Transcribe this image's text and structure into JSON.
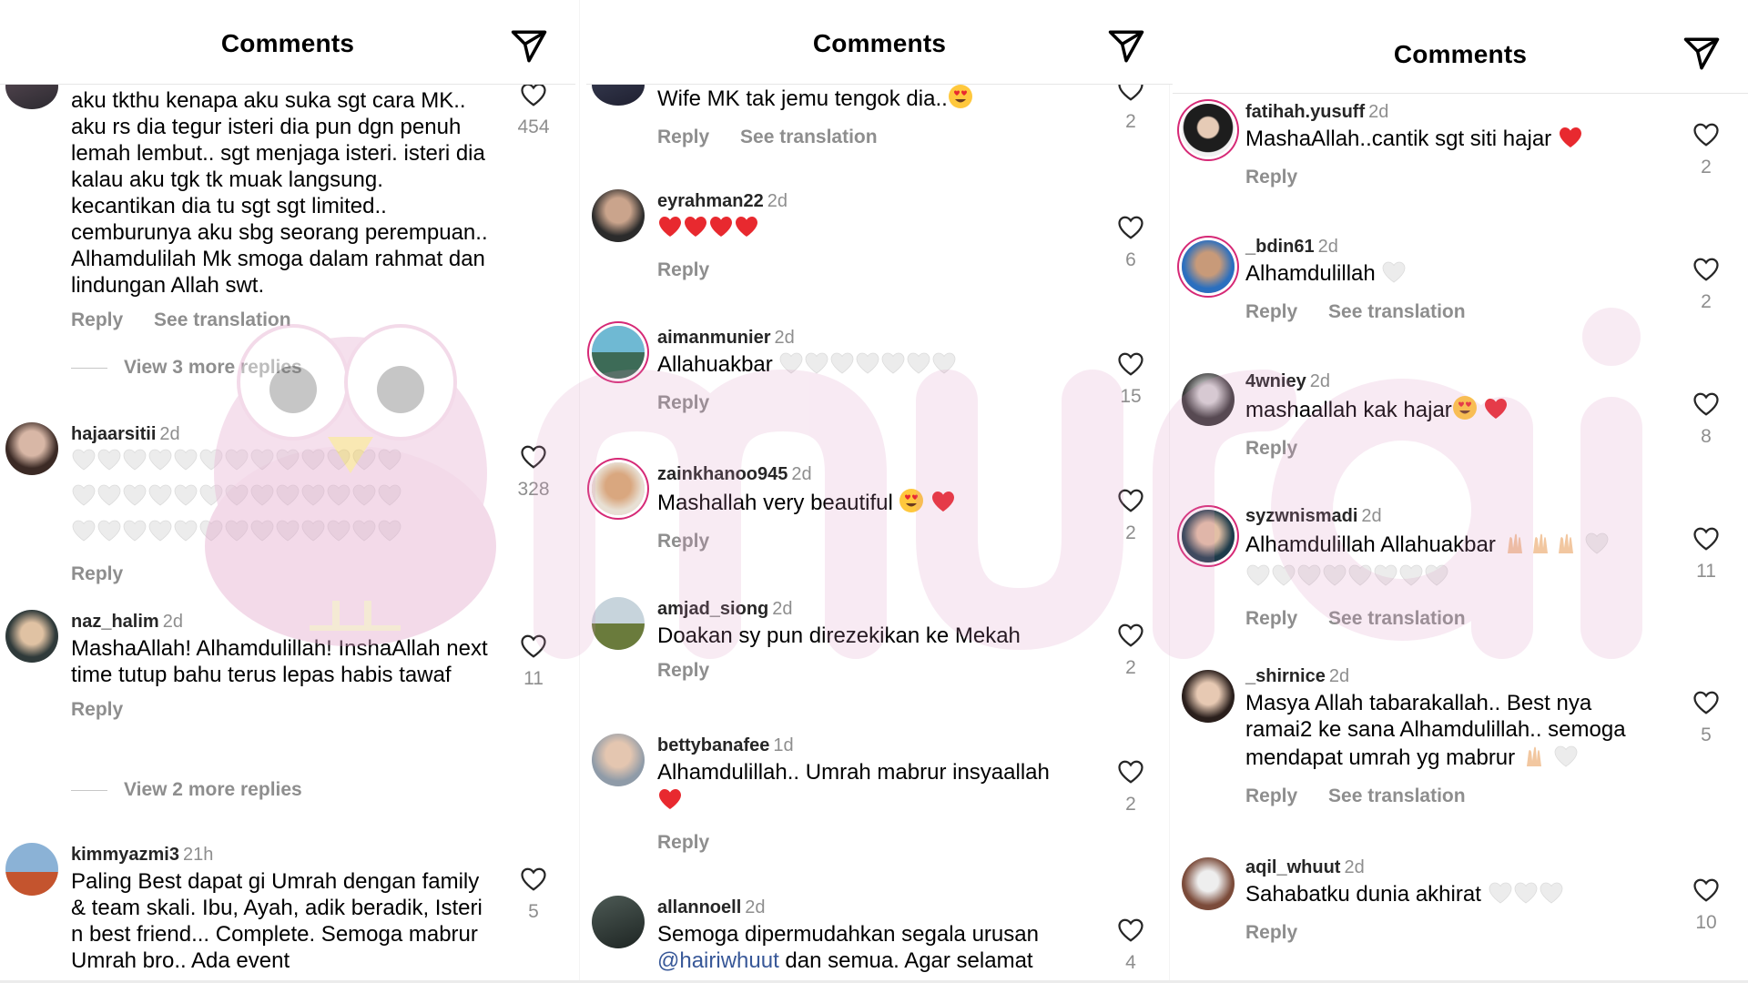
{
  "colors": {
    "heart_red": "#e8292f",
    "heart_white": "#ececec",
    "meta_gray": "#8e8e8e",
    "mention_blue": "#385898",
    "watermark_pink": "#e9c3de"
  },
  "panels": [
    {
      "title": "Comments",
      "comments": [
        {
          "username": "",
          "time": "",
          "text": "aku tkthu kenapa aku suka sgt cara MK.. aku rs dia tegur isteri dia pun dgn penuh lemah lembut.. sgt menjaga isteri. isteri dia kalau aku tgk tk muak langsung. kecantikan dia tu sgt sgt limited.. cemburunya aku sbg seorang perempuan.. Alhamdulilah Mk smoga dalam rahmat dan lindungan Allah swt.",
          "reply": "Reply",
          "see_translation": "See translation",
          "likes": "454",
          "view_replies": "View 3 more replies"
        },
        {
          "username": "hajaarsitii",
          "time": "2d",
          "text": "",
          "reply": "Reply",
          "likes": "328"
        },
        {
          "username": "naz_halim",
          "time": "2d",
          "text": "MashaAllah! Alhamdulillah! InshaAllah next time tutup bahu terus lepas habis tawaf",
          "reply": "Reply",
          "likes": "11",
          "view_replies": "View 2 more replies"
        },
        {
          "username": "kimmyazmi3",
          "time": "21h",
          "text": "Paling Best dapat gi Umrah dengan family & team skali. Ibu, Ayah, adik beradik, Isteri n best friend... Complete. Semoga mabrur Umrah bro.. Ada event",
          "likes": "5"
        }
      ]
    },
    {
      "title": "Comments",
      "comments": [
        {
          "username": "",
          "time": "",
          "text": "Wife MK tak jemu tengok dia..",
          "reply": "Reply",
          "see_translation": "See translation",
          "likes": "2"
        },
        {
          "username": "eyrahman22",
          "time": "2d",
          "text": "",
          "reply": "Reply",
          "likes": "6"
        },
        {
          "username": "aimanmunier",
          "time": "2d",
          "text": "Allahuakbar",
          "reply": "Reply",
          "likes": "15"
        },
        {
          "username": "zainkhanoo945",
          "time": "2d",
          "text": "Mashallah very beautiful",
          "reply": "Reply",
          "likes": "2"
        },
        {
          "username": "amjad_siong",
          "time": "2d",
          "text": "Doakan sy pun direzekikan ke Mekah",
          "reply": "Reply",
          "likes": "2"
        },
        {
          "username": "bettybanafee",
          "time": "1d",
          "text": "Alhamdulillah.. Umrah mabrur insyaallah",
          "reply": "Reply",
          "likes": "2"
        },
        {
          "username": "allannoell",
          "time": "2d",
          "text": "Semoga dipermudahkan segala urusan",
          "mention": "@hairiwhuut",
          "text_after": " dan semua. Agar selamat",
          "likes": "4"
        }
      ]
    },
    {
      "title": "Comments",
      "comments": [
        {
          "username": "fatihah.yusuff",
          "time": "2d",
          "text": "MashaAllah..cantik sgt siti hajar",
          "reply": "Reply",
          "likes": "2"
        },
        {
          "username": "_bdin61",
          "time": "2d",
          "text": "Alhamdulillah",
          "reply": "Reply",
          "see_translation": "See translation",
          "likes": "2"
        },
        {
          "username": "4wniey",
          "time": "2d",
          "text": "mashaallah kak hajar",
          "reply": "Reply",
          "likes": "8"
        },
        {
          "username": "syzwnismadi",
          "time": "2d",
          "text": "Alhamdulillah Allahuakbar",
          "reply": "Reply",
          "see_translation": "See translation",
          "likes": "11"
        },
        {
          "username": "_shirnice",
          "time": "2d",
          "text": "Masya Allah tabarakallah.. Best nya ramai2 ke sana Alhamdulillah.. semoga mendapat umrah yg mabrur",
          "reply": "Reply",
          "see_translation": "See translation",
          "likes": "5"
        },
        {
          "username": "aqil_whuut",
          "time": "2d",
          "text": "Sahabatku dunia akhirat",
          "reply": "Reply",
          "likes": "10"
        }
      ]
    }
  ]
}
